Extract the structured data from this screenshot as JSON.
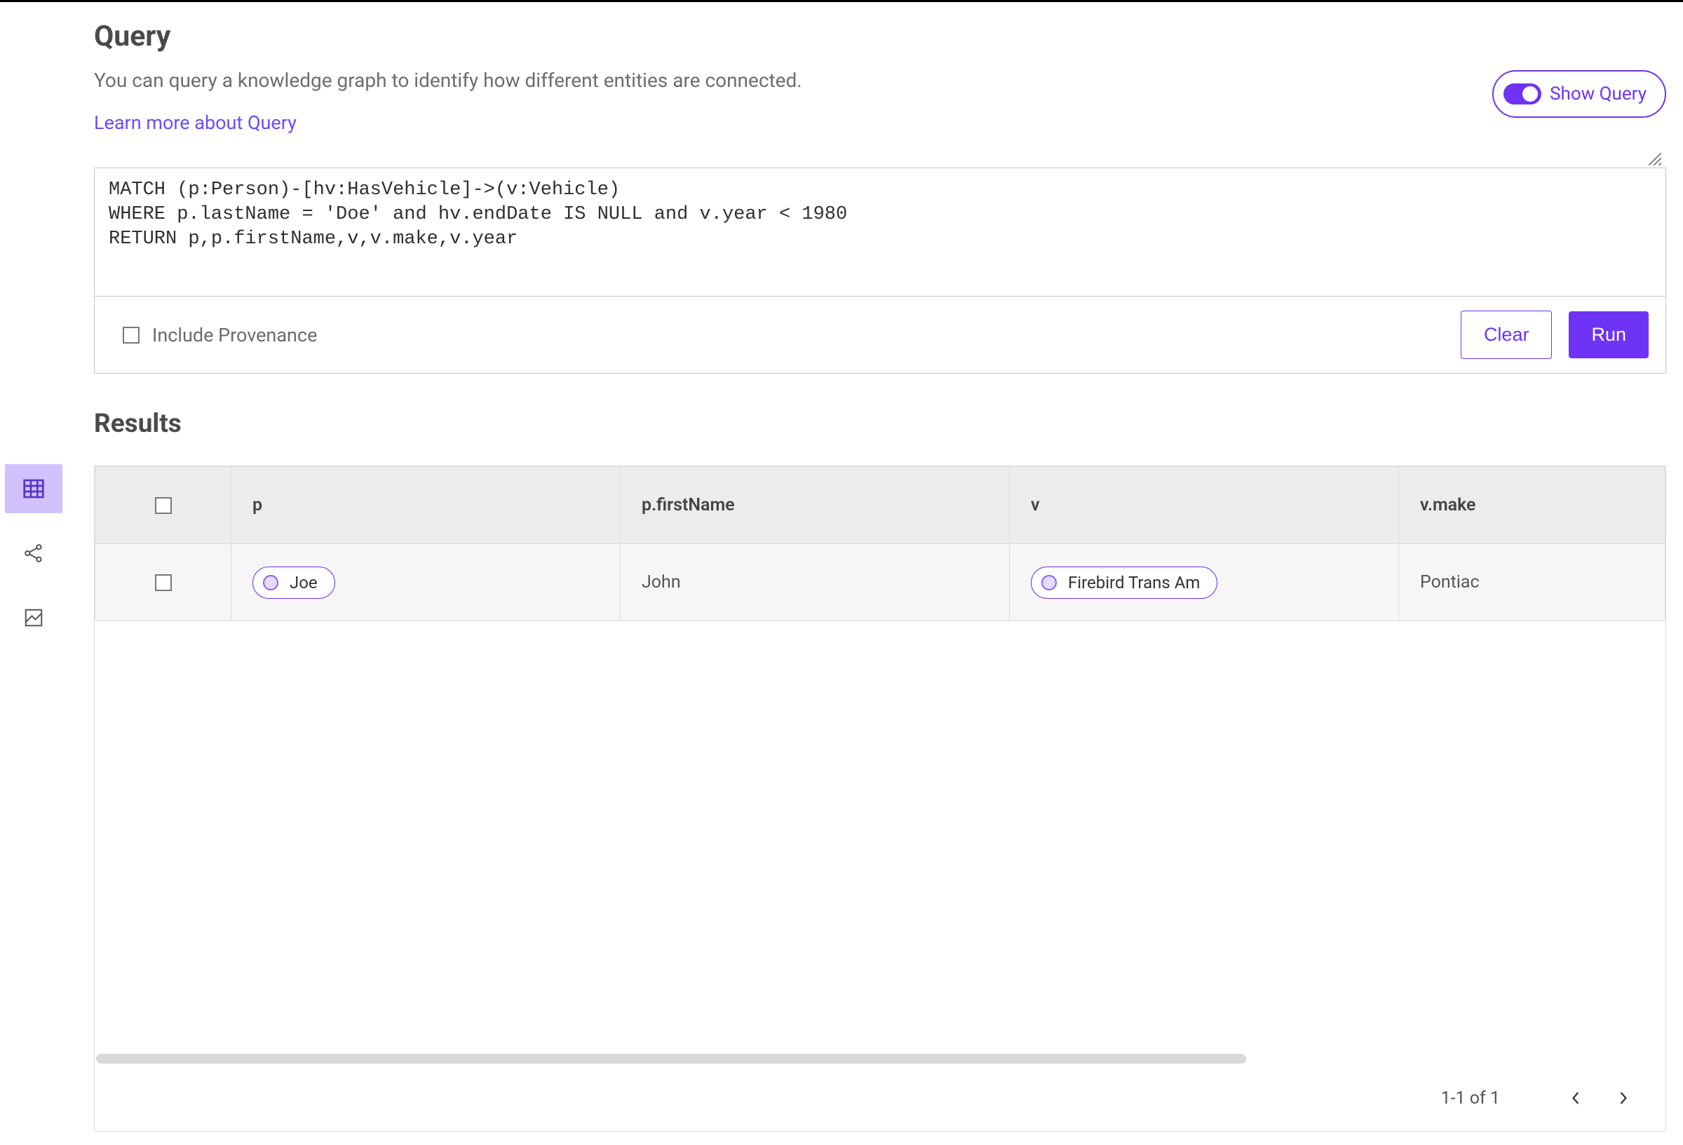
{
  "header": {
    "title": "Query",
    "subtitle": "You can query a knowledge graph to identify how different entities are connected.",
    "learn_link": "Learn more about Query",
    "show_query_label": "Show Query"
  },
  "query": {
    "text": "MATCH (p:Person)-[hv:HasVehicle]->(v:Vehicle)\nWHERE p.lastName = 'Doe' and hv.endDate IS NULL and v.year < 1980\nRETURN p,p.firstName,v,v.make,v.year",
    "include_provenance_label": "Include Provenance",
    "clear_label": "Clear",
    "run_label": "Run"
  },
  "results": {
    "title": "Results",
    "columns": {
      "p": "p",
      "firstName": "p.firstName",
      "v": "v",
      "make": "v.make"
    },
    "rows": [
      {
        "p_entity": "Joe",
        "firstName": "John",
        "v_entity": "Firebird Trans Am",
        "make": "Pontiac"
      }
    ],
    "pager": "1-1 of 1"
  }
}
